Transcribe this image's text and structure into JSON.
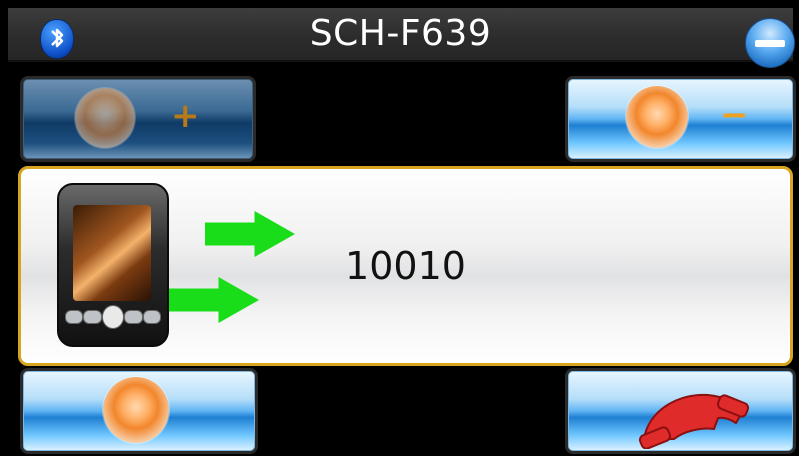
{
  "header": {
    "title": "SCH-F639",
    "left_icon": "bluetooth-icon",
    "right_icon": "minimize-icon"
  },
  "controls": {
    "volume_up": {
      "icon": "speaker-icon",
      "symbol": "+"
    },
    "volume_down": {
      "icon": "speaker-icon",
      "symbol": "−"
    },
    "speaker": {
      "icon": "speaker-icon"
    },
    "hang_up": {
      "icon": "hang-up-icon"
    }
  },
  "call": {
    "number": "10010",
    "device_icon": "phone-device-icon",
    "direction_icon": "outgoing-arrows-icon"
  },
  "colors": {
    "accent_border": "#d9a520",
    "button_blue": "#1f7fd2",
    "arrow_green": "#18dd18",
    "hangup_red": "#e02b2b"
  }
}
